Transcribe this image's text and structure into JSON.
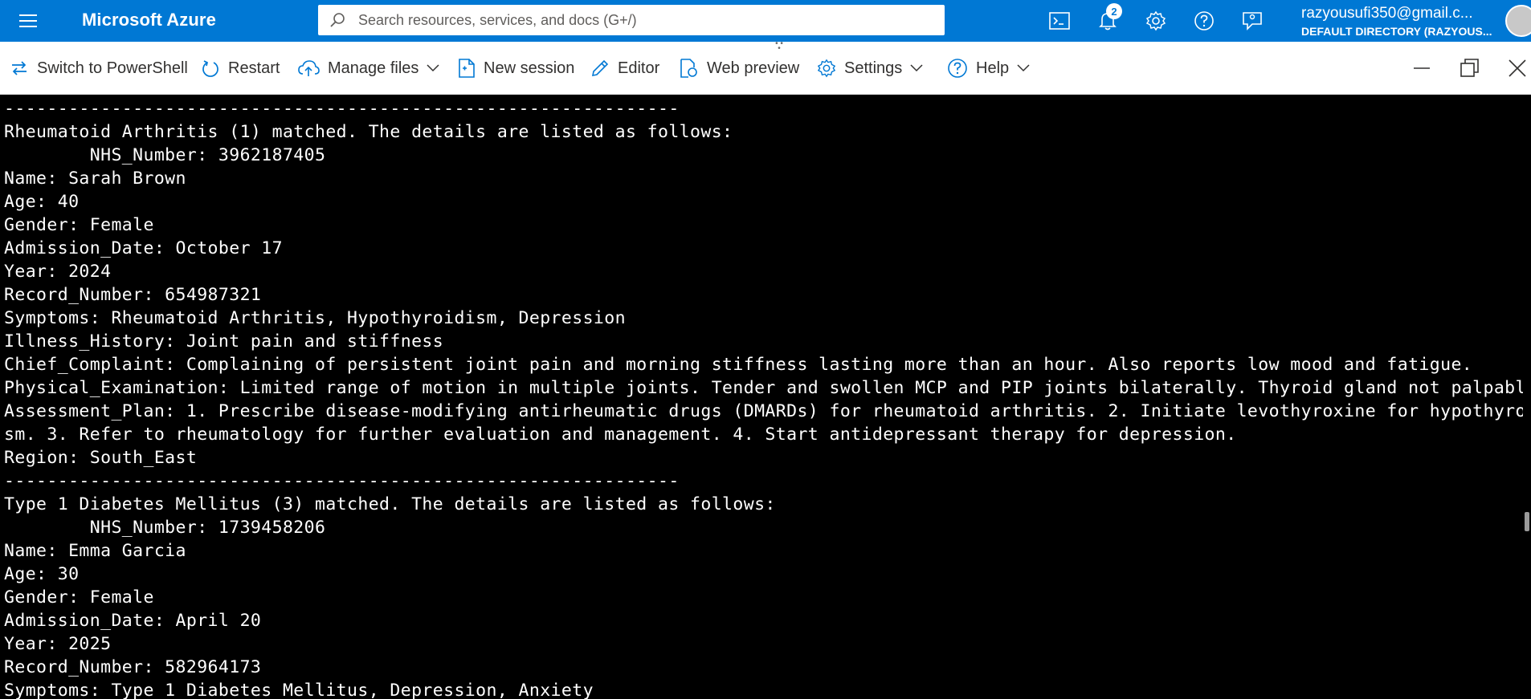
{
  "topbar": {
    "brand": "Microsoft Azure",
    "search_placeholder": "Search resources, services, and docs (G+/)",
    "notification_count": "2",
    "account_email": "razyousufi350@gmail.c...",
    "account_directory": "DEFAULT DIRECTORY (RAZYOUS..."
  },
  "toolbar": {
    "switch_label": "Switch to PowerShell",
    "restart_label": "Restart",
    "manage_files_label": "Manage files",
    "new_session_label": "New session",
    "editor_label": "Editor",
    "web_preview_label": "Web preview",
    "settings_label": "Settings",
    "help_label": "Help"
  },
  "terminal": {
    "lines": [
      "---------------------------------------------------------------",
      "Rheumatoid Arthritis (1) matched. The details are listed as follows:",
      "        NHS_Number: 3962187405",
      "Name: Sarah Brown",
      "Age: 40",
      "Gender: Female",
      "Admission_Date: October 17",
      "Year: 2024",
      "Record_Number: 654987321",
      "Symptoms: Rheumatoid Arthritis, Hypothyroidism, Depression",
      "Illness_History: Joint pain and stiffness",
      "Chief_Complaint: Complaining of persistent joint pain and morning stiffness lasting more than an hour. Also reports low mood and fatigue.",
      "Physical_Examination: Limited range of motion in multiple joints. Tender and swollen MCP and PIP joints bilaterally. Thyroid gland not palpable.",
      "Assessment_Plan: 1. Prescribe disease-modifying antirheumatic drugs (DMARDs) for rheumatoid arthritis. 2. Initiate levothyroxine for hypothyroidi",
      "sm. 3. Refer to rheumatology for further evaluation and management. 4. Start antidepressant therapy for depression.",
      "Region: South_East",
      "---------------------------------------------------------------",
      "Type 1 Diabetes Mellitus (3) matched. The details are listed as follows:",
      "        NHS_Number: 1739458206",
      "Name: Emma Garcia",
      "Age: 30",
      "Gender: Female",
      "Admission_Date: April 20",
      "Year: 2025",
      "Record_Number: 582964173",
      "Symptoms: Type 1 Diabetes Mellitus, Depression, Anxiety"
    ]
  }
}
